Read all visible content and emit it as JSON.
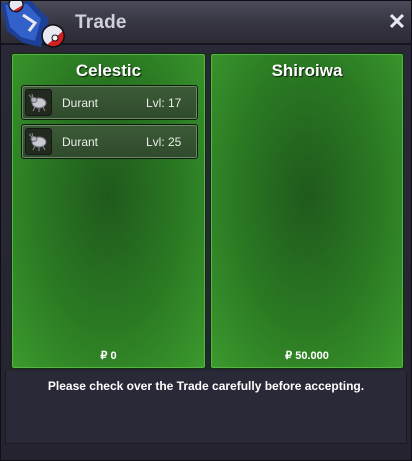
{
  "window": {
    "title": "Trade",
    "close_glyph": "✕",
    "logo_icon": "pokeball-logo-icon"
  },
  "left_panel": {
    "player_name": "Celestic",
    "items": [
      {
        "icon": "durant-icon",
        "name": "Durant",
        "level": "Lvl: 17"
      },
      {
        "icon": "durant-icon",
        "name": "Durant",
        "level": "Lvl: 25"
      }
    ],
    "money": "₽ 0"
  },
  "right_panel": {
    "player_name": "Shiroiwa",
    "items": [],
    "money": "₽ 50.000"
  },
  "footer": {
    "message": "Please check over the Trade carefully before accepting."
  },
  "colors": {
    "panel_green": "#2b7a23",
    "titlebar": "#3a3946",
    "window_bg": "#262532"
  }
}
